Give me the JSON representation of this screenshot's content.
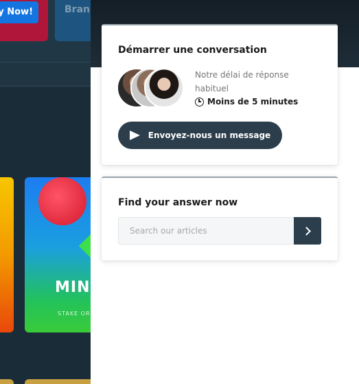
{
  "background": {
    "play_button_label": "y Now!",
    "brand_label": "Bran",
    "mines_title": "MINI",
    "mines_subtitle": "STAKE ORIG"
  },
  "conversation_card": {
    "title": "Démarrer une conversation",
    "reply_label": "Notre délai de réponse habituel",
    "reply_time": "Moins de 5 minutes",
    "send_button_label": "Envoyez-nous un message"
  },
  "search_card": {
    "title": "Find your answer now",
    "search_placeholder": "Search our articles"
  },
  "colors": {
    "panel_header": "#1f2d38",
    "primary_button": "#2c3e4c",
    "page_background": "#1a2c38"
  }
}
